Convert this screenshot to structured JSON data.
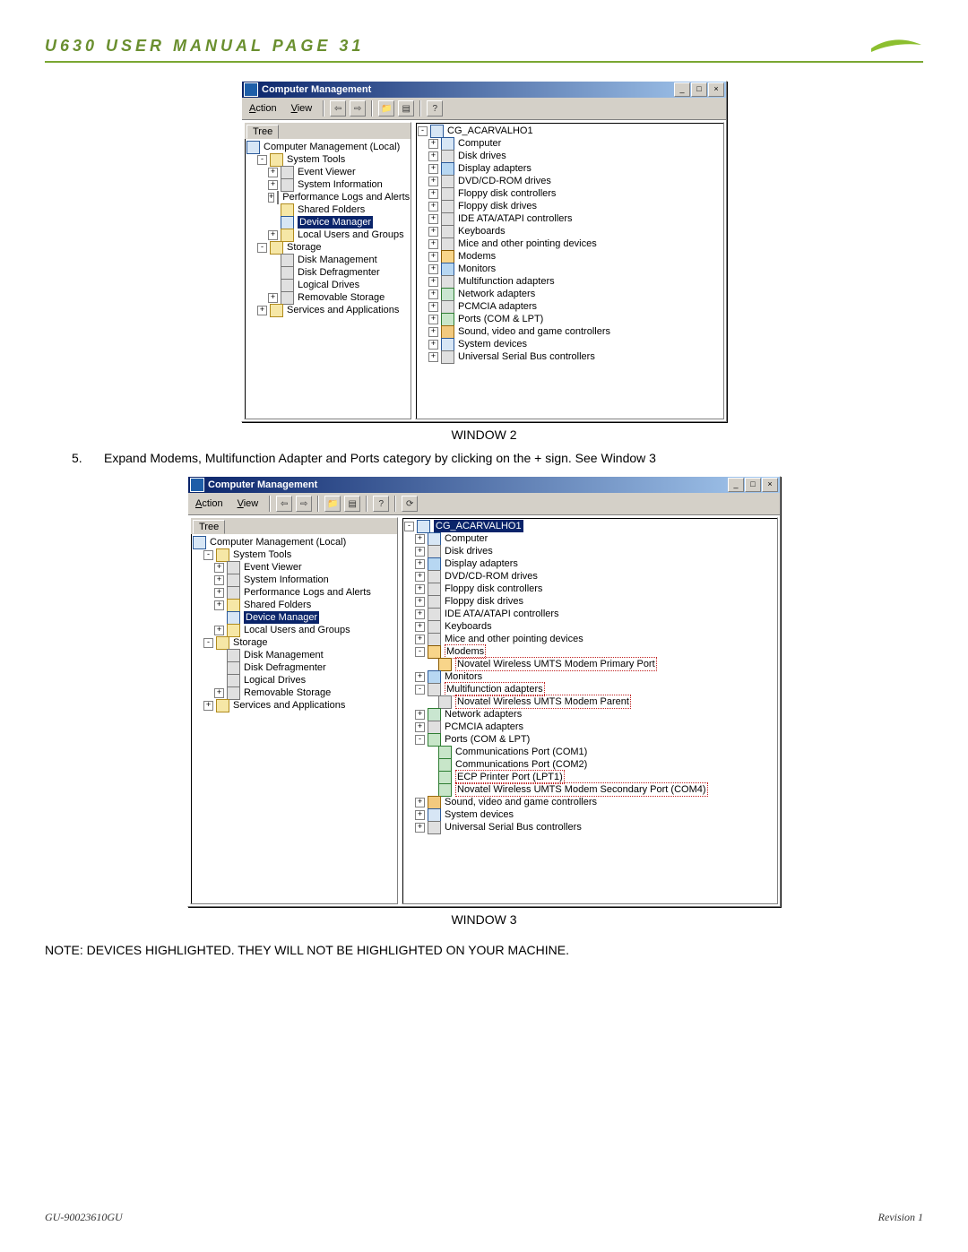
{
  "doc": {
    "header_title": "U630 USER MANUAL PAGE 31",
    "caption_window2": "WINDOW 2",
    "caption_window3": "WINDOW 3",
    "step_num": "5.",
    "step_text": "Expand Modems, Multifunction Adapter and Ports category by clicking on the + sign.  See Window 3",
    "note_text": "NOTE:  DEVICES HIGHLIGHTED.  THEY WILL NOT BE HIGHLIGHTED ON YOUR MACHINE.",
    "footer_left": "GU-90023610GU",
    "footer_right": "Revision 1"
  },
  "win": {
    "title": "Computer Management",
    "menu_action": "Action",
    "menu_view": "View",
    "tree_tab": "Tree",
    "root": "Computer Management (Local)",
    "system_tools": "System Tools",
    "event_viewer": "Event Viewer",
    "system_information": "System Information",
    "perf_logs": "Performance Logs and Alerts",
    "shared_folders": "Shared Folders",
    "device_manager": "Device Manager",
    "local_users": "Local Users and Groups",
    "storage": "Storage",
    "disk_management": "Disk Management",
    "disk_defrag": "Disk Defragmenter",
    "logical_drives": "Logical Drives",
    "removable_storage": "Removable Storage",
    "services_apps": "Services and Applications"
  },
  "dev": {
    "host": "CG_ACARVALHO1",
    "computer": "Computer",
    "disk_drives": "Disk drives",
    "display_adapters": "Display adapters",
    "dvd_cdrom": "DVD/CD-ROM drives",
    "floppy_ctrl": "Floppy disk controllers",
    "floppy_drives": "Floppy disk drives",
    "ide": "IDE ATA/ATAPI controllers",
    "keyboards": "Keyboards",
    "mice": "Mice and other pointing devices",
    "modems": "Modems",
    "modem_primary": "Novatel Wireless UMTS Modem Primary Port",
    "monitors": "Monitors",
    "multifunction": "Multifunction adapters",
    "modem_parent": "Novatel Wireless UMTS Modem Parent",
    "network": "Network adapters",
    "pcmcia": "PCMCIA adapters",
    "ports": "Ports (COM & LPT)",
    "com1": "Communications Port (COM1)",
    "com2": "Communications Port (COM2)",
    "lpt1": "ECP Printer Port (LPT1)",
    "modem_secondary": "Novatel Wireless UMTS Modem Secondary Port (COM4)",
    "sound": "Sound, video and game controllers",
    "system_devices": "System devices",
    "usb": "Universal Serial Bus controllers"
  }
}
